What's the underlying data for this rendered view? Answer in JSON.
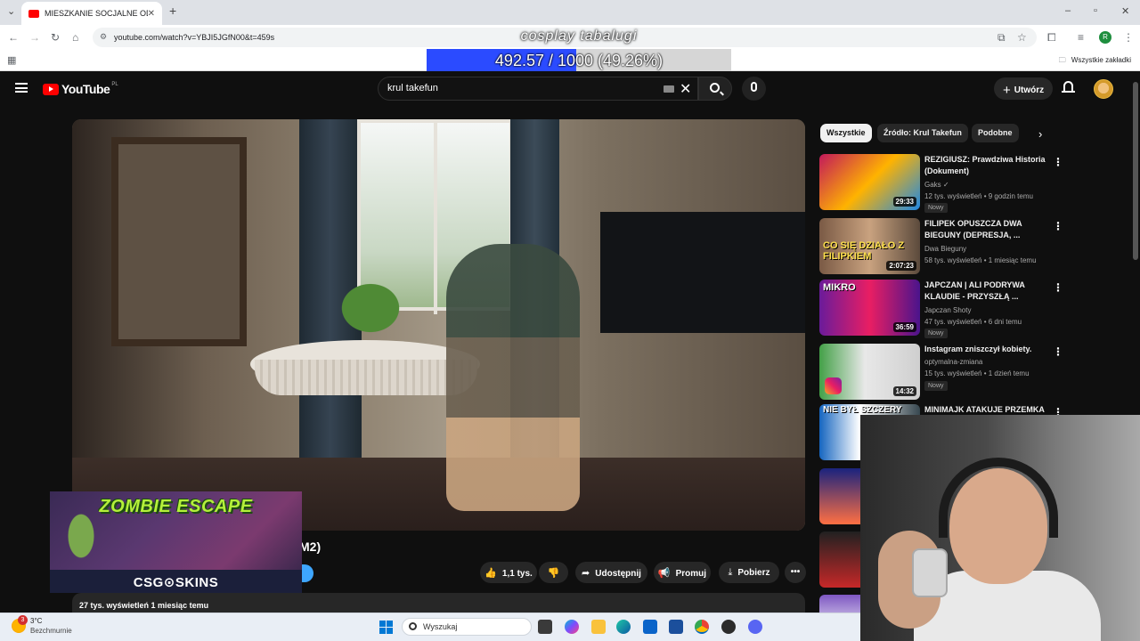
{
  "browser": {
    "tab_title": "MIESZKANIE SOCJALNE OD M...",
    "tab_close": "✕",
    "new_tab": "+",
    "url": "youtube.com/watch?v=YBJI5JGfN00&t=459s",
    "bookmarks_folder": "Wszystkie zakładki",
    "profile_letter": "R"
  },
  "overlay": {
    "title": "cosplay tabalugi",
    "progress_text": "492.57 / 1000 (49.26%)",
    "progress_fraction": 0.4926
  },
  "youtube": {
    "logo_text": "YouTube",
    "country_code": "PL",
    "search_query": "krul takefun",
    "create_label": "Utwórz"
  },
  "video": {
    "title_tail": "M2)",
    "stats": "27 tys. wyświetleń  1 miesiąc temu",
    "actions": {
      "like": "1,1 tys.",
      "share": "Udostępnij",
      "promote": "Promuj",
      "download": "Pobierz"
    }
  },
  "sponsor": {
    "title": "ZOMBIE ESCAPE",
    "brand": "CSG⊙SKINS"
  },
  "chips": [
    "Wszystkie",
    "Źródło: Krul Takefun",
    "Podobne"
  ],
  "recommendations": [
    {
      "title": "REZIGIUSZ: Prawdziwa Historia (Dokument)",
      "channel": "Gaks ✓",
      "meta": "12 tys. wyświetleń • 9 godzin temu",
      "badge": "Nowy",
      "duration": "29:33",
      "thumb_text": ""
    },
    {
      "title": "FILIPEK OPUSZCZA DWA BIEGUNY (DEPRESJA, ...",
      "channel": "Dwa Bieguny",
      "meta": "58 tys. wyświetleń • 1 miesiąc temu",
      "badge": "",
      "duration": "2:07:23",
      "thumb_text": "CO SIĘ DZIAŁO Z FILIPKIEM"
    },
    {
      "title": "JAPCZAN | ALI PODRYWA KLAUDIE - PRZYSZŁĄ ...",
      "channel": "Japczan Shoty",
      "meta": "47 tys. wyświetleń • 6 dni temu",
      "badge": "Nowy",
      "duration": "36:59",
      "thumb_text": "MIKRO"
    },
    {
      "title": "Instagram zniszczył kobiety.",
      "channel": "optymalna-zmiana",
      "meta": "15 tys. wyświetleń • 1 dzień temu",
      "badge": "Nowy",
      "duration": "14:32",
      "thumb_text": ""
    },
    {
      "title": "MINIMAJK ATAKUJE PRZEMKA",
      "channel": "",
      "meta": "",
      "badge": "",
      "duration": "",
      "thumb_text": "NIE BYŁ SZCZERY"
    }
  ],
  "taskbar": {
    "weather_badge": "3",
    "temperature": "3°C",
    "condition": "Bezchmurnie",
    "search_placeholder": "Wyszukaj"
  },
  "colors": {
    "youtube_red": "#ff0000",
    "subscribe_blue": "#3ea6ff",
    "progress_blue": "#2b4bff",
    "zombie_green": "#b4f03a"
  }
}
